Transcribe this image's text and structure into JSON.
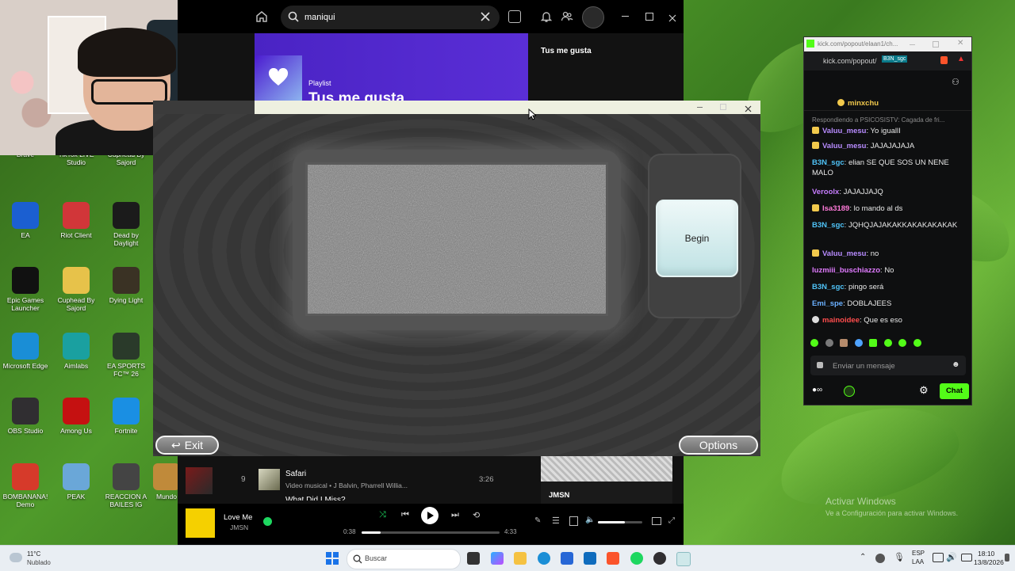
{
  "desktop": {
    "icons": [
      {
        "label": "Brave",
        "color": "#fb542b"
      },
      {
        "label": "TikTok LIVE Studio",
        "color": "#000000"
      },
      {
        "label": "Cuphead By Sajord",
        "color": "#7a3d1d"
      },
      {
        "label": "EA",
        "color": "#1b5fd1"
      },
      {
        "label": "Riot Client",
        "color": "#d13639"
      },
      {
        "label": "Dead by Daylight",
        "color": "#1b1b1b"
      },
      {
        "label": "Epic Games Launcher",
        "color": "#111111"
      },
      {
        "label": "Cuphead By Sajord",
        "color": "#e7c24a"
      },
      {
        "label": "Dying Light",
        "color": "#3a3224"
      },
      {
        "label": "Microsoft Edge",
        "color": "#1a8ed6"
      },
      {
        "label": "Aimlabs",
        "color": "#1aa0a0"
      },
      {
        "label": "EA SPORTS FC™ 26",
        "color": "#2a3a2a"
      },
      {
        "label": "OBS Studio",
        "color": "#302e31"
      },
      {
        "label": "Among Us",
        "color": "#c51111"
      },
      {
        "label": "Fortnite",
        "color": "#1a8fe3"
      },
      {
        "label": "BOMBANANA! Demo",
        "color": "#d63a2a"
      },
      {
        "label": "PEAK",
        "color": "#6aa7d8"
      },
      {
        "label": "REACCION A BAILES IG",
        "color": "#444444"
      },
      {
        "label": "Mundo",
        "color": "#c08a3a"
      }
    ],
    "watermark_title": "Activar Windows",
    "watermark_sub": "Ve a Configuración para activar Windows."
  },
  "spotify": {
    "search_value": "maniqui",
    "banner_type": "Playlist",
    "banner_title": "Tus me gusta",
    "side_title": "Tus me gusta",
    "track_number": "9",
    "track_title": "Safari",
    "track_artists": "Video musical • J Balvin, Pharrell Willia...",
    "track_duration": "3:26",
    "next_track_partial": "What Did I Miss?",
    "artist_card": "JMSN",
    "now_playing_title": "Love Me",
    "now_playing_artist": "JMSN",
    "time_elapsed": "0:38",
    "time_total": "4:33",
    "progress": 0.14,
    "volume": 0.6
  },
  "game": {
    "begin_label": "Begin",
    "exit_label": "Exit",
    "options_label": "Options"
  },
  "chat": {
    "window_title": "kick.com/popout/elaan1/ch...",
    "url": "kick.com/popout/",
    "overlay_tag": "B3N_sgc",
    "pinned_user": "minxchu",
    "reply_header": "Respondiendo a PSICOSISTV: Cagada de fri...",
    "messages": [
      {
        "user": "Valuu_mesu",
        "color": "#b88cff",
        "text": ": Yo iguallI"
      },
      {
        "user": "Valuu_mesu",
        "color": "#b88cff",
        "text": ": JAJAJAJAJA"
      },
      {
        "user": "B3N_sgc",
        "color": "#4fc3f7",
        "text": ": elian SE QUE SOS UN NENE MALO"
      },
      {
        "user": "Veroolx",
        "color": "#c77dff",
        "text": ": JAJAJJAJQ"
      },
      {
        "user": "Isa3189",
        "color": "#ff7ad9",
        "text": ": lo mando al ds"
      },
      {
        "user": "B3N_sgc",
        "color": "#4fc3f7",
        "text": ": JQHQJAJAKAKKAKAKAKAKAK"
      },
      {
        "user": "Valuu_mesu",
        "color": "#b88cff",
        "text": ": no"
      },
      {
        "user": "luzmiii_buschiazzo",
        "color": "#e07bff",
        "text": ": No"
      },
      {
        "user": "B3N_sgc",
        "color": "#4fc3f7",
        "text": ": pingo será"
      },
      {
        "user": "Emi_spe",
        "color": "#6ab0ff",
        "text": ": DOBLAJEES"
      },
      {
        "user": "mainoidee",
        "color": "#ff4d4d",
        "text": ": Que es eso"
      }
    ],
    "input_placeholder": "Enviar un mensaje",
    "send_label": "Chat"
  },
  "taskbar": {
    "temperature": "11°C",
    "weather": "Nublado",
    "search_placeholder": "Buscar",
    "lang": "ESP",
    "lang_sub": "LAA",
    "time": "18:10",
    "date": "13/8/2026"
  }
}
